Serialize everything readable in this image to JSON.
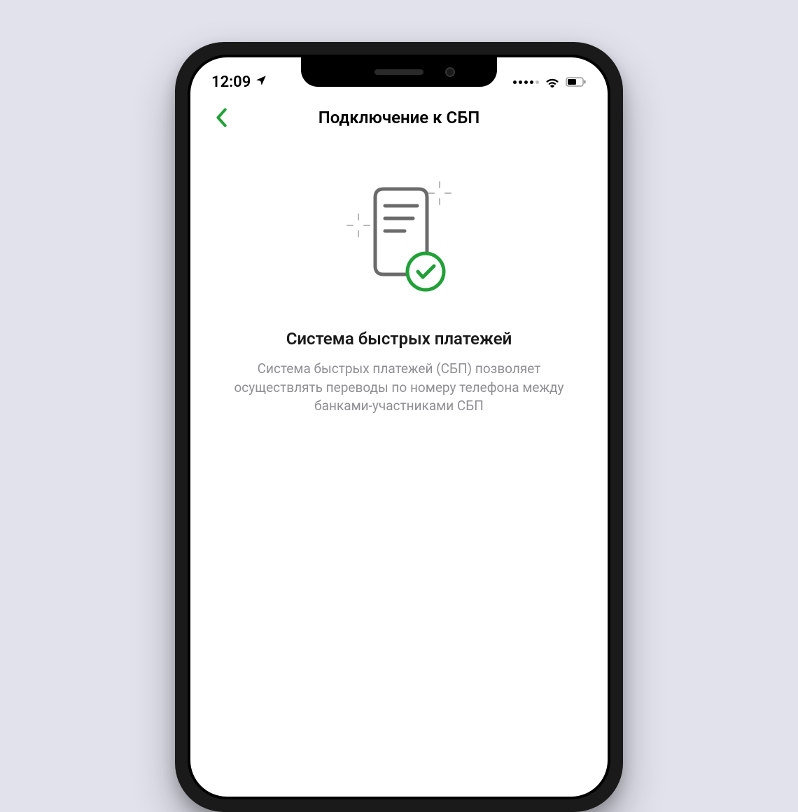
{
  "status_bar": {
    "time": "12:09"
  },
  "nav": {
    "title": "Подключение к СБП"
  },
  "content": {
    "title": "Система быстрых платежей",
    "description": "Система быстрых платежей (СБП) позволяет осуществлять переводы по номеру телефона между банками-участниками СБП"
  },
  "colors": {
    "accent": "#21a038",
    "text_primary": "#000000",
    "text_secondary": "#8e8e93",
    "background": "#e2e2ed"
  }
}
